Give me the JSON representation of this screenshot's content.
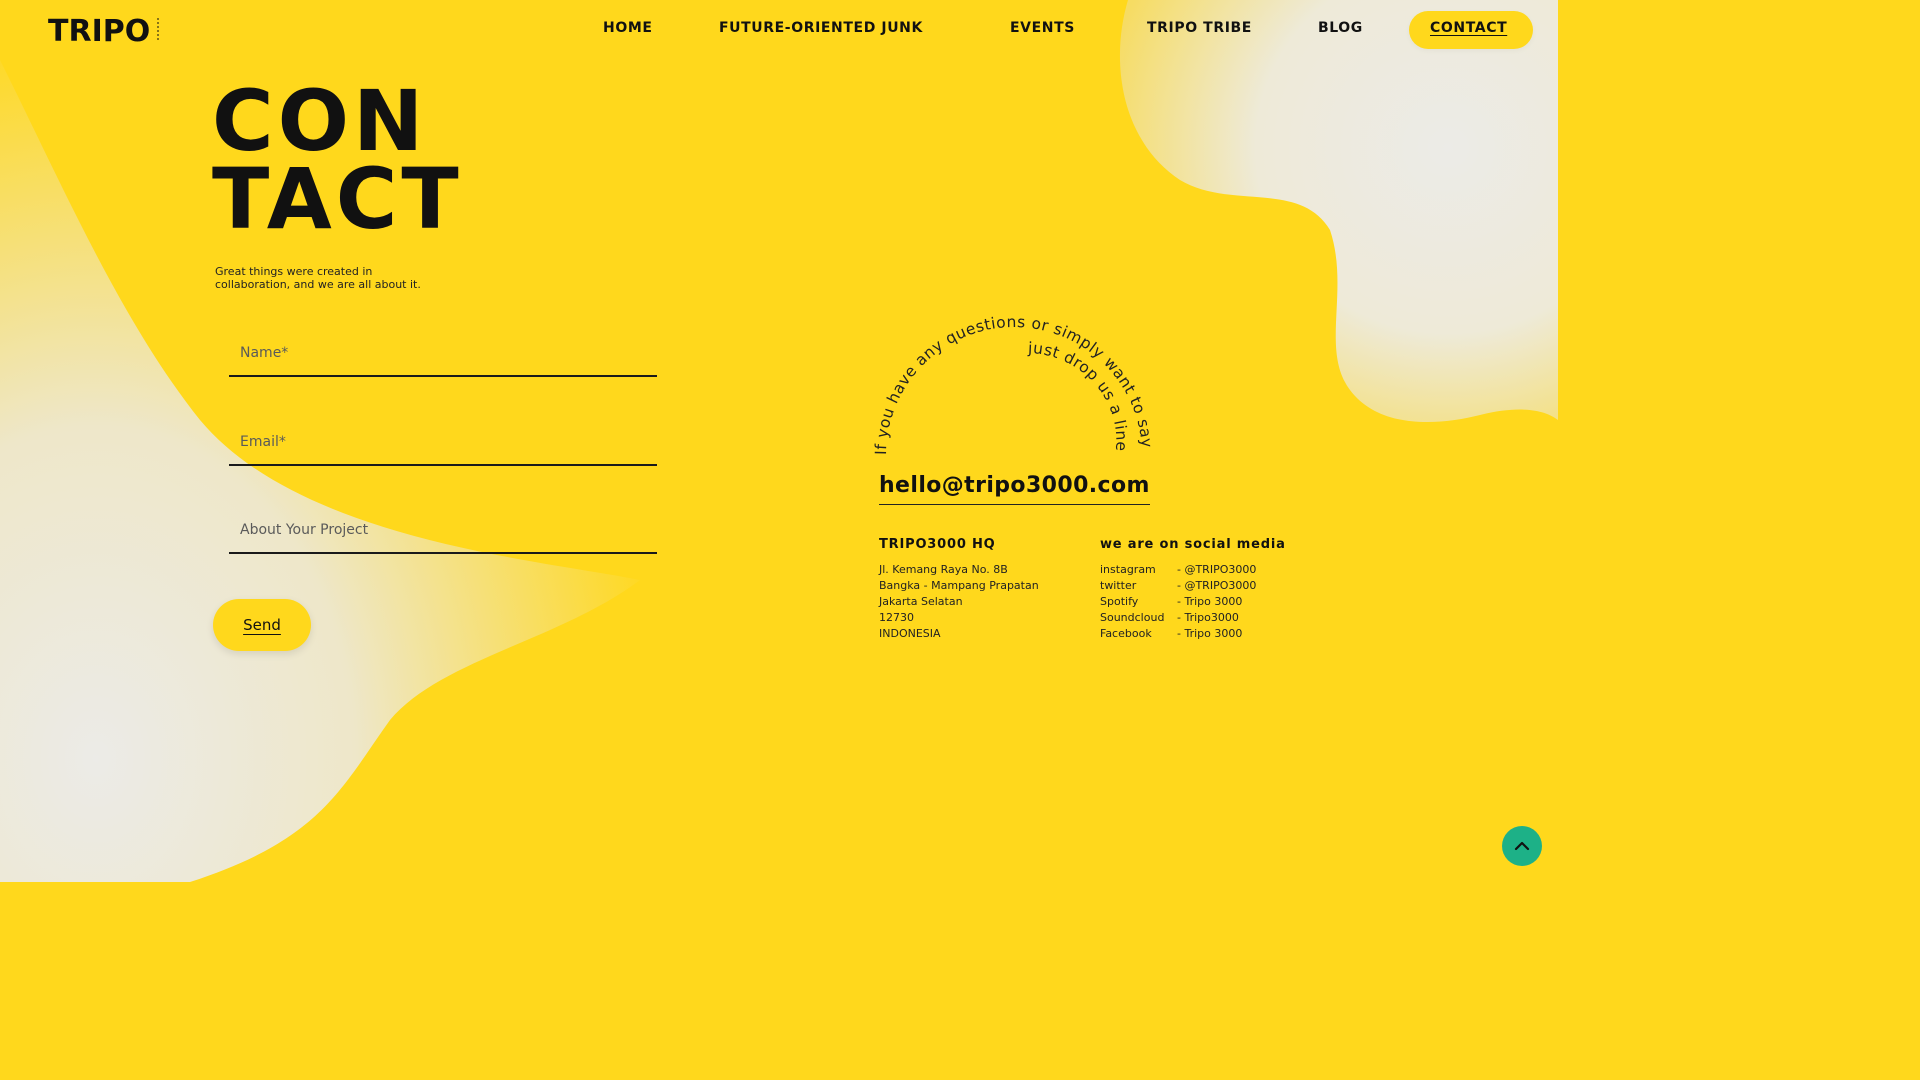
{
  "brand": {
    "logo_text": "TRIPO"
  },
  "colors": {
    "background": "#FFD81C",
    "blob": "#EDEBE6",
    "text": "#111111",
    "back_to_top": "#1DB187"
  },
  "nav": {
    "items": [
      {
        "label": "HOME"
      },
      {
        "label": "FUTURE-ORIENTED JUNK"
      },
      {
        "label": "EVENTS"
      },
      {
        "label": "TRIPO TRIBE"
      },
      {
        "label": "BLOG"
      },
      {
        "label": "CONTACT",
        "active": true
      }
    ]
  },
  "hero": {
    "title_line1": "CON",
    "title_line2": "TACT",
    "subtitle": "Great things were created in collaboration, and we are all about it."
  },
  "form": {
    "name_placeholder": "Name*",
    "email_placeholder": "Email*",
    "project_placeholder": "About Your Project",
    "send_label": "Send"
  },
  "contact": {
    "arc_outer": "If you have any questions or simply want to say hi",
    "arc_inner": "just drop us a line",
    "email": "hello@tripo3000.com",
    "hq": {
      "heading": "TRIPO3000 HQ",
      "lines": [
        "Jl. Kemang Raya No. 8B",
        "Bangka - Mampang Prapatan",
        "Jakarta Selatan",
        "12730",
        "INDONESIA"
      ]
    },
    "social": {
      "heading": "we are on social media",
      "items": [
        {
          "name": "instagram",
          "handle": "- @TRIPO3000"
        },
        {
          "name": "twitter",
          "handle": "- @TRIPO3000"
        },
        {
          "name": "Spotify",
          "handle": "- Tripo 3000"
        },
        {
          "name": "Soundcloud",
          "handle": "- Tripo3000"
        },
        {
          "name": "Facebook",
          "handle": "- Tripo 3000"
        }
      ]
    }
  },
  "icons": {
    "back_to_top": "chevron-up-icon"
  }
}
